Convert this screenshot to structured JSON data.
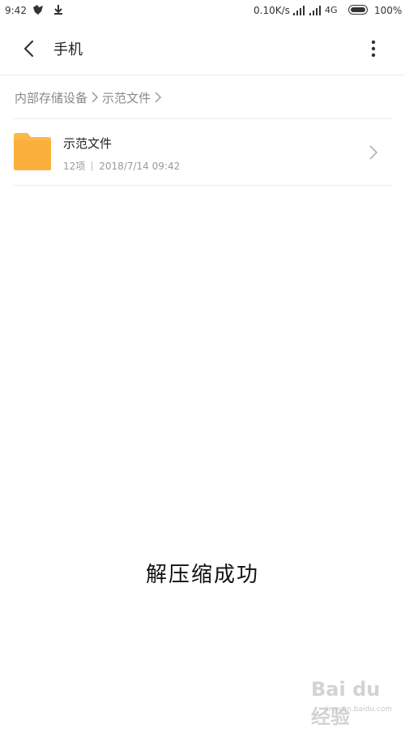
{
  "status_bar": {
    "time": "9:42",
    "network_speed": "0.10K/s",
    "network_type": "4G",
    "battery": "100%"
  },
  "header": {
    "title": "手机",
    "back_icon": "chevron-left-icon",
    "more_icon": "more-vertical-icon"
  },
  "breadcrumb": [
    {
      "label": "内部存储设备"
    },
    {
      "label": "示范文件"
    }
  ],
  "files": [
    {
      "name": "示范文件",
      "count": "12项",
      "date": "2018/7/14 09:42",
      "icon": "folder-icon",
      "icon_color": "#FDB84A"
    }
  ],
  "caption": "解压缩成功",
  "watermark": {
    "main": "Bai du 经验",
    "sub": "jingyan.baidu.com"
  },
  "colors": {
    "folder": "#FDB84A",
    "text_primary": "#222222",
    "text_secondary": "#9a9a9a"
  }
}
